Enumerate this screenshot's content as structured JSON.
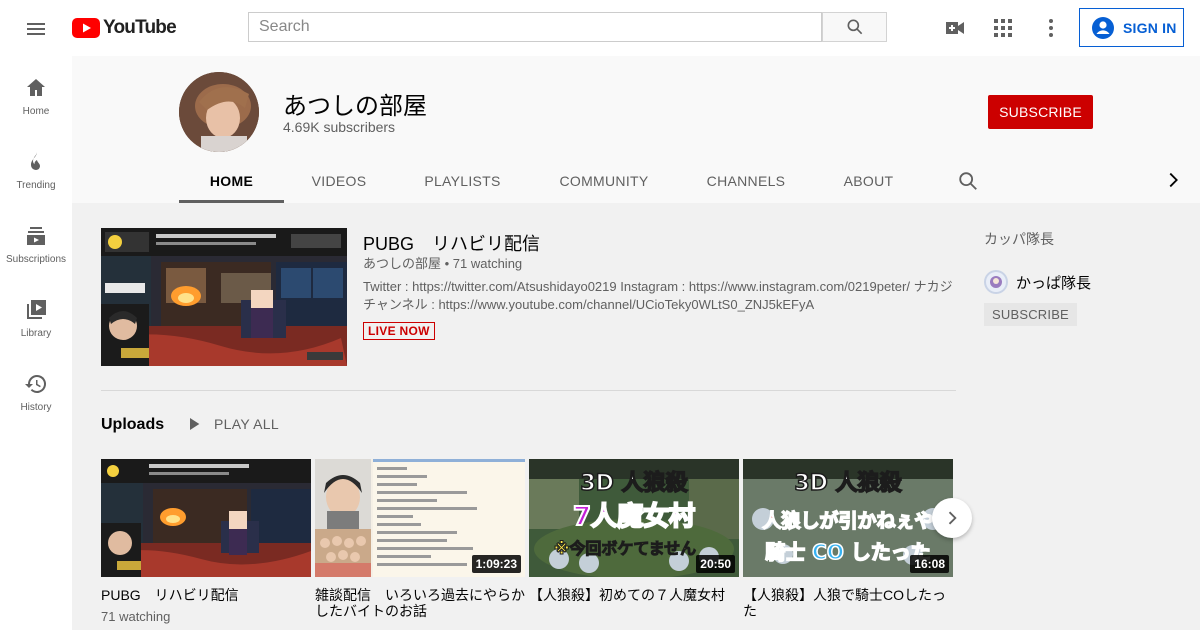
{
  "header": {
    "logo_text": "YouTube",
    "search_placeholder": "Search",
    "signin_label": "SIGN IN",
    "brand_color": "#ff0000",
    "accent_color": "#065fd4"
  },
  "guide": {
    "items": [
      {
        "label": "Home",
        "icon": "home-icon"
      },
      {
        "label": "Trending",
        "icon": "flame-icon"
      },
      {
        "label": "Subscriptions",
        "icon": "subscriptions-icon"
      },
      {
        "label": "Library",
        "icon": "library-icon"
      },
      {
        "label": "History",
        "icon": "history-icon"
      }
    ]
  },
  "channel": {
    "title": "あつしの部屋",
    "subscribers": "4.69K subscribers",
    "subscribe_label": "SUBSCRIBE",
    "subscribe_color": "#cc0000"
  },
  "tabs": [
    {
      "label": "HOME",
      "active": true
    },
    {
      "label": "VIDEOS"
    },
    {
      "label": "PLAYLISTS"
    },
    {
      "label": "COMMUNITY"
    },
    {
      "label": "CHANNELS"
    },
    {
      "label": "ABOUT"
    }
  ],
  "featured": {
    "title": "PUBG　リハビリ配信",
    "meta": "あつしの部屋 • 71 watching",
    "description": "Twitter : https://twitter.com/Atsushidayo0219 Instagram : https://www.instagram.com/0219peter/ ナカジチャンネル : https://www.youtube.com/channel/UCioTeky0WLtS0_ZNJ5kEFyA",
    "live_label": "LIVE NOW"
  },
  "uploads": {
    "title": "Uploads",
    "play_all": "PLAY ALL",
    "videos": [
      {
        "title": "PUBG　リハビリ配信",
        "meta": "71 watching",
        "duration": ""
      },
      {
        "title": "雑談配信　いろいろ過去にやらかしたバイトのお話",
        "meta": "",
        "duration": "1:09:23"
      },
      {
        "title": "【人狼殺】初めての７人魔女村",
        "meta": "",
        "duration": "20:50",
        "thumb_lines": [
          "3D 人狼殺",
          "7人魔女村",
          "※今回ボケてません"
        ]
      },
      {
        "title": "【人狼殺】人狼で騎士COしたった",
        "meta": "",
        "duration": "16:08",
        "thumb_lines": [
          "3D 人狼殺",
          "人狼しが引かねぇや",
          "騎士 CO したった"
        ]
      }
    ]
  },
  "sidebar": {
    "label": "カッパ隊長",
    "channel_name": "かっぱ隊長",
    "subscribe_label": "SUBSCRIBE"
  }
}
